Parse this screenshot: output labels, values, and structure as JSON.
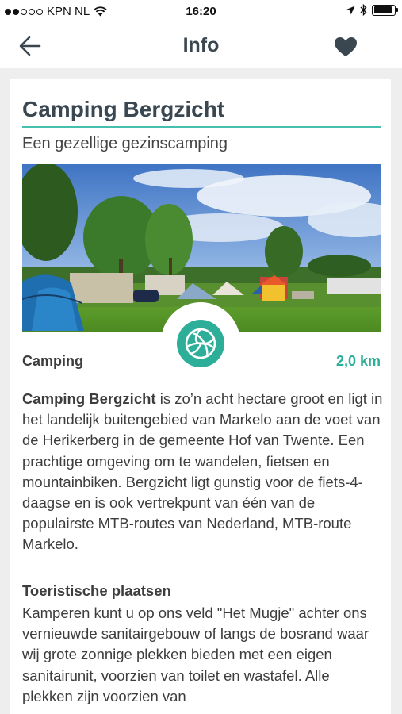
{
  "status_bar": {
    "carrier": "KPN NL",
    "time": "16:20",
    "signal_icon": "signal-dots-icon",
    "wifi_icon": "wifi-icon",
    "location_icon": "location-arrow-icon",
    "bluetooth_icon": "bluetooth-icon",
    "battery_icon": "battery-icon",
    "battery_level": 0.9
  },
  "nav": {
    "title": "Info",
    "back_icon": "back-arrow-icon",
    "favorite_icon": "heart-icon"
  },
  "detail": {
    "name": "Camping Bergzicht",
    "tagline": "Een gezellige gezinscamping",
    "category": "Camping",
    "distance": "2,0 km",
    "category_icon": "volleyball-icon",
    "accent_color": "#2cae98",
    "intro_bold": "Camping Bergzicht",
    "intro_text": " is zo’n acht hectare groot en ligt in het landelijk buitengebied van Markelo aan de voet van de Herikerberg in de gemeente Hof van Twente. Een prachtige omgeving om te wandelen, fietsen en mountainbiken. Bergzicht ligt gunstig voor de fiets-4-daagse en is ook vertrekpunt van één van de populairste MTB-routes van Nederland, MTB-route Markelo.",
    "section_heading": "Toeristische plaatsen",
    "section_text": "Kamperen kunt u op ons veld \"Het Mugje\" achter ons vernieuwde sanitairgebouw of langs de bosrand waar wij grote zonnige plekken bieden met een eigen sanitairunit, voorzien van toilet en wastafel. Alle plekken zijn voorzien van"
  }
}
